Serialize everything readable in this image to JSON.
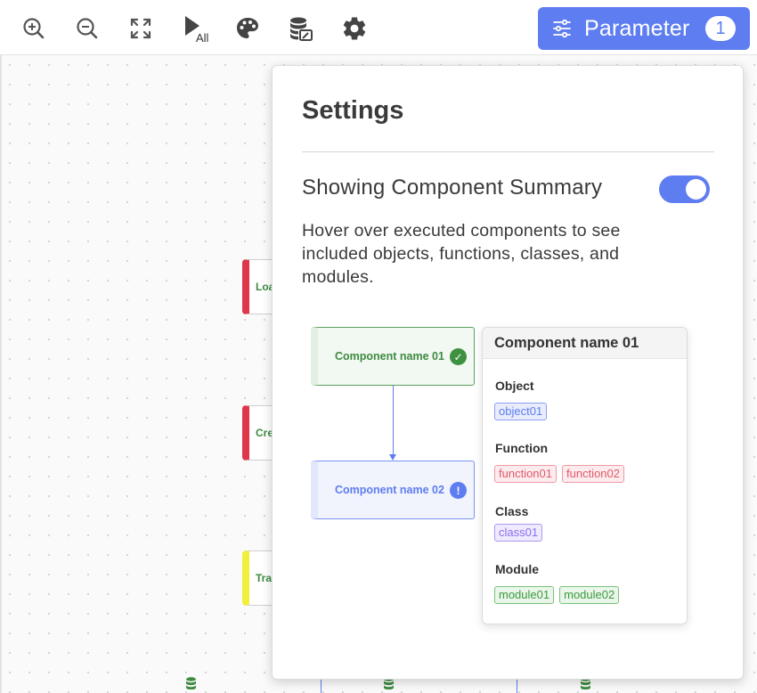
{
  "toolbar": {
    "icons": [
      "zoom-in-icon",
      "zoom-out-icon",
      "fit-screen-icon",
      "run-all-icon",
      "palette-icon",
      "data-icon",
      "gear-icon"
    ],
    "run_all_label": "All",
    "parameter": {
      "label": "Parameter",
      "count": "1"
    }
  },
  "canvas": {
    "nodes": [
      {
        "label": "Loa",
        "color": "#e0364a"
      },
      {
        "label": "Cre",
        "color": "#e0364a"
      },
      {
        "label": "Tra",
        "color": "#f2ef3a"
      }
    ]
  },
  "settings": {
    "title": "Settings",
    "toggle_label": "Showing Component Summary",
    "toggle_on": true,
    "description": "Hover over executed components to see included objects, functions, classes, and modules.",
    "example": {
      "node_ok": "Component name 01",
      "node_warn": "Component name 02",
      "summary": {
        "title": "Component name 01",
        "object_label": "Object",
        "objects": [
          "object01"
        ],
        "function_label": "Function",
        "functions": [
          "function01",
          "function02"
        ],
        "class_label": "Class",
        "classes": [
          "class01"
        ],
        "module_label": "Module",
        "modules": [
          "module01",
          "module02"
        ]
      }
    }
  },
  "colors": {
    "accent": "#5e7df0",
    "success": "#3f9142",
    "error": "#e0364a",
    "warning": "#f2ef3a"
  }
}
